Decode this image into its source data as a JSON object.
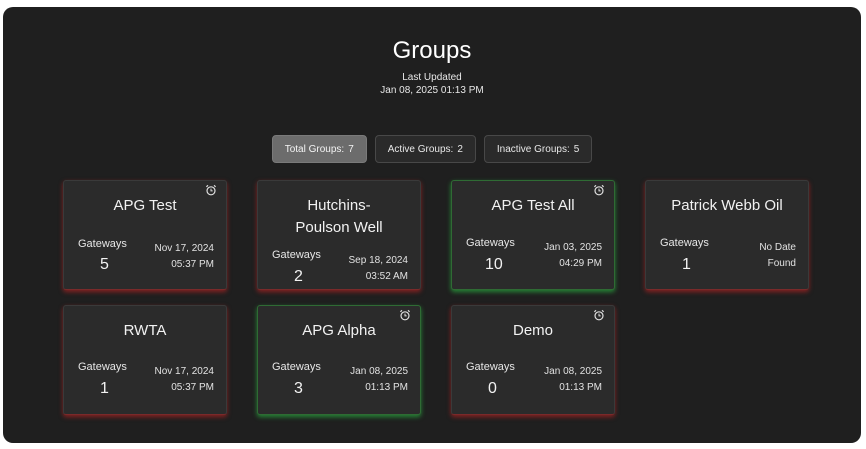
{
  "page": {
    "title": "Groups",
    "last_updated_label": "Last Updated",
    "last_updated_value": "Jan 08, 2025 01:13 PM"
  },
  "stats": {
    "total": {
      "label": "Total Groups:",
      "value": "7"
    },
    "active": {
      "label": "Active Groups:",
      "value": "2"
    },
    "inactive": {
      "label": "Inactive Groups:",
      "value": "5"
    }
  },
  "gateways_label": "Gateways",
  "groups": [
    {
      "name": "APG Test",
      "count": "5",
      "date": "Nov 17, 2024",
      "time": "05:37 PM",
      "status": "inactive",
      "alarm_icon": "alarm-clock-icon"
    },
    {
      "name": "Hutchins-Poulson Well",
      "count": "2",
      "date": "Sep 18, 2024",
      "time": "03:52 AM",
      "status": "inactive"
    },
    {
      "name": "APG Test All",
      "count": "10",
      "date": "Jan 03, 2025",
      "time": "04:29 PM",
      "status": "active",
      "alarm_icon": "alarm-clock-icon"
    },
    {
      "name": "Patrick Webb Oil",
      "count": "1",
      "date": "No Date",
      "time": "Found",
      "status": "inactive"
    },
    {
      "name": "RWTA",
      "count": "1",
      "date": "Nov 17, 2024",
      "time": "05:37 PM",
      "status": "inactive"
    },
    {
      "name": "APG Alpha",
      "count": "3",
      "date": "Jan 08, 2025",
      "time": "01:13 PM",
      "status": "active",
      "alarm_icon": "alarm-clock-icon"
    },
    {
      "name": "Demo",
      "count": "0",
      "date": "Jan 08, 2025",
      "time": "01:13 PM",
      "status": "inactive",
      "alarm_icon": "alarm-clock-icon"
    }
  ],
  "colors": {
    "background": "#1f1f1f",
    "card": "#2b2b2b",
    "active_glow": "#2fa046",
    "inactive_glow": "#aa2323"
  }
}
